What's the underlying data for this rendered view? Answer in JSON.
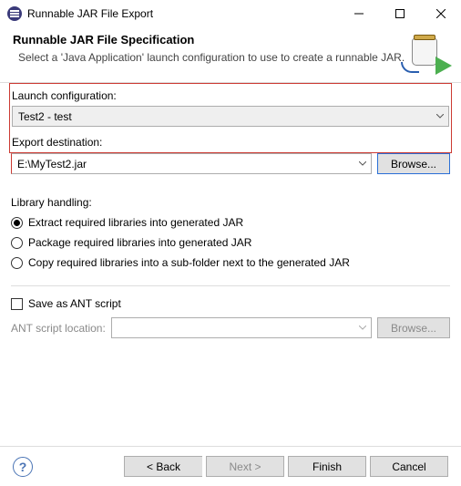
{
  "window": {
    "title": "Runnable JAR File Export"
  },
  "header": {
    "title": "Runnable JAR File Specification",
    "subtitle": "Select a 'Java Application' launch configuration to use to create a runnable JAR."
  },
  "launch": {
    "label": "Launch configuration:",
    "value": "Test2 - test"
  },
  "export": {
    "label": "Export destination:",
    "value": "E:\\MyTest2.jar",
    "browse": "Browse..."
  },
  "library": {
    "label": "Library handling:",
    "opt_extract": "Extract required libraries into generated JAR",
    "opt_package": "Package required libraries into generated JAR",
    "opt_copy": "Copy required libraries into a sub-folder next to the generated JAR",
    "selected": "extract"
  },
  "ant": {
    "save_label": "Save as ANT script",
    "location_label": "ANT script location:",
    "location_value": "",
    "browse": "Browse..."
  },
  "footer": {
    "back": "< Back",
    "next": "Next >",
    "finish": "Finish",
    "cancel": "Cancel"
  }
}
